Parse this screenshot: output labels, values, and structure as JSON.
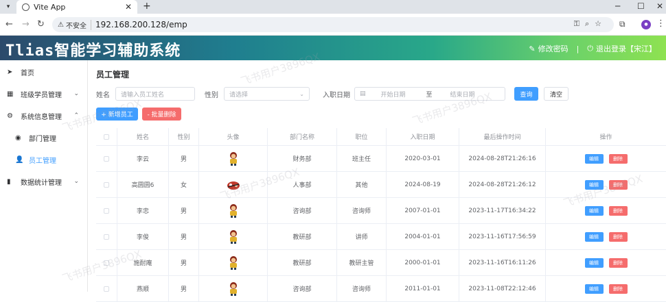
{
  "browser": {
    "tab_title": "Vite App",
    "insecure_label": "不安全",
    "url": "192.168.200.128/emp"
  },
  "header": {
    "app_title": "Tlias智能学习辅助系统",
    "change_password": "修改密码",
    "separator": "|",
    "logout": "退出登录【宋江】"
  },
  "sidebar": {
    "items": [
      {
        "label": "首页",
        "icon": "send-icon"
      },
      {
        "label": "班级学员管理",
        "icon": "grid-icon"
      },
      {
        "label": "系统信息管理",
        "icon": "gear-icon"
      },
      {
        "label": "部门管理",
        "icon": "circle-icon"
      },
      {
        "label": "员工管理",
        "icon": "user-icon"
      },
      {
        "label": "数据统计管理",
        "icon": "bar-chart-icon"
      }
    ]
  },
  "page": {
    "title": "员工管理",
    "filters": {
      "name_label": "姓名",
      "name_placeholder": "请输入员工姓名",
      "gender_label": "性别",
      "gender_placeholder": "请选择",
      "date_label": "入职日期",
      "start_placeholder": "开始日期",
      "range_sep": "至",
      "end_placeholder": "结束日期",
      "query_button": "查询",
      "clear_button": "清空"
    },
    "actions": {
      "add_button": "+ 新增员工",
      "batch_delete_button": "- 批量删除"
    }
  },
  "table": {
    "columns": [
      "姓名",
      "性别",
      "头像",
      "部门名称",
      "职位",
      "入职日期",
      "最后操作时间",
      "操作"
    ],
    "edit_label": "编辑",
    "delete_label": "删除",
    "rows": [
      {
        "name": "李云",
        "gender": "男",
        "dept": "财务部",
        "job": "班主任",
        "entry_date": "2020-03-01",
        "update_time": "2024-08-28T21:26:16"
      },
      {
        "name": "高圆圆6",
        "gender": "女",
        "dept": "人事部",
        "job": "其他",
        "entry_date": "2024-08-19",
        "update_time": "2024-08-28T21:26:12"
      },
      {
        "name": "李忠",
        "gender": "男",
        "dept": "咨询部",
        "job": "咨询师",
        "entry_date": "2007-01-01",
        "update_time": "2023-11-17T16:34:22"
      },
      {
        "name": "李俊",
        "gender": "男",
        "dept": "教研部",
        "job": "讲师",
        "entry_date": "2004-01-01",
        "update_time": "2023-11-16T17:56:59"
      },
      {
        "name": "施耐庵",
        "gender": "男",
        "dept": "教研部",
        "job": "教研主管",
        "entry_date": "2000-01-01",
        "update_time": "2023-11-16T16:11:26"
      },
      {
        "name": "燕顺",
        "gender": "男",
        "dept": "咨询部",
        "job": "咨询师",
        "entry_date": "2011-01-01",
        "update_time": "2023-11-08T22:12:46"
      }
    ]
  },
  "watermark_text": "飞书用户3896QX",
  "colors": {
    "primary": "#409eff",
    "danger": "#f56c6c"
  }
}
